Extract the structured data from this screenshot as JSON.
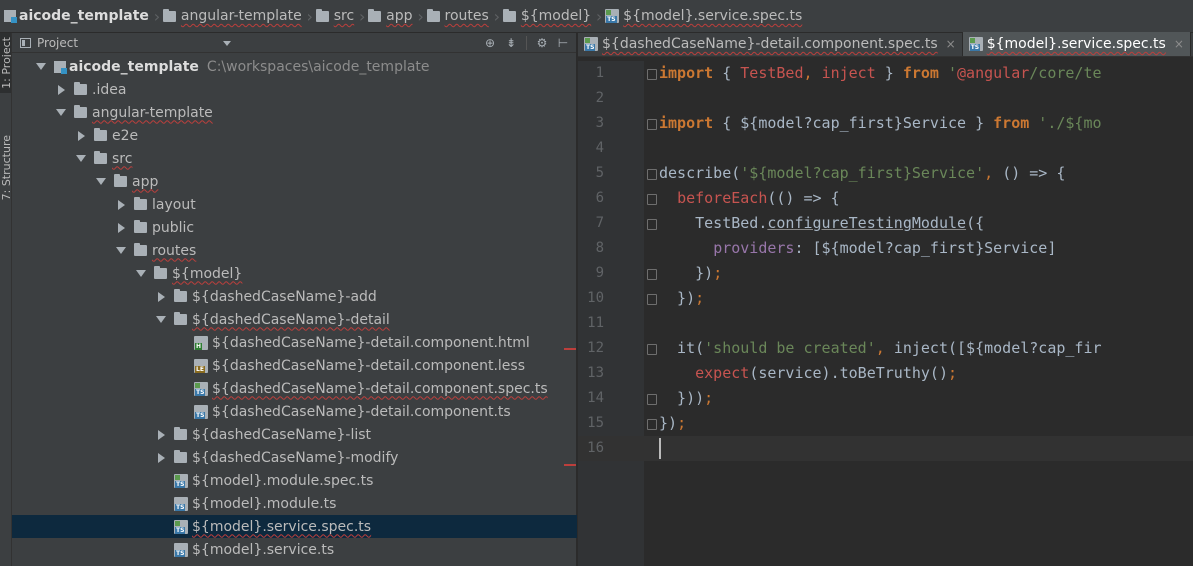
{
  "breadcrumb": [
    "aicode_template",
    "angular-template",
    "src",
    "app",
    "routes",
    "${model}",
    "${model}.service.spec.ts"
  ],
  "left_strip": {
    "project_tab": "1: Project",
    "structure_tab": "7: Structure"
  },
  "project_panel": {
    "title": "Project",
    "tools": [
      "locate-icon",
      "collapse-icon",
      "settings-icon",
      "hide-icon"
    ]
  },
  "tree": [
    {
      "label": "aicode_template",
      "path": "C:\\workspaces\\aicode_template",
      "level": 0,
      "toggle": "down",
      "icon": "module",
      "bold": true
    },
    {
      "label": ".idea",
      "level": 1,
      "toggle": "right",
      "icon": "folder"
    },
    {
      "label": "angular-template",
      "level": 1,
      "toggle": "down",
      "icon": "folder",
      "wavy": true
    },
    {
      "label": "e2e",
      "level": 2,
      "toggle": "right",
      "icon": "folder"
    },
    {
      "label": "src",
      "level": 2,
      "toggle": "down",
      "icon": "folder",
      "wavy": true
    },
    {
      "label": "app",
      "level": 3,
      "toggle": "down",
      "icon": "folder",
      "wavy": true
    },
    {
      "label": "layout",
      "level": 4,
      "toggle": "right",
      "icon": "folder"
    },
    {
      "label": "public",
      "level": 4,
      "toggle": "right",
      "icon": "folder"
    },
    {
      "label": "routes",
      "level": 4,
      "toggle": "down",
      "icon": "folder",
      "wavy": true
    },
    {
      "label": "${model}",
      "level": 5,
      "toggle": "down",
      "icon": "folder",
      "wavy": true
    },
    {
      "label": "${dashedCaseName}-add",
      "level": 6,
      "toggle": "right",
      "icon": "folder"
    },
    {
      "label": "${dashedCaseName}-detail",
      "level": 6,
      "toggle": "down",
      "icon": "folder",
      "wavy": true
    },
    {
      "label": "${dashedCaseName}-detail.component.html",
      "level": 7,
      "toggle": "none",
      "icon": "html"
    },
    {
      "label": "${dashedCaseName}-detail.component.less",
      "level": 7,
      "toggle": "none",
      "icon": "less"
    },
    {
      "label": "${dashedCaseName}-detail.component.spec.ts",
      "level": 7,
      "toggle": "none",
      "icon": "ts-spec",
      "wavy": true
    },
    {
      "label": "${dashedCaseName}-detail.component.ts",
      "level": 7,
      "toggle": "none",
      "icon": "ts"
    },
    {
      "label": "${dashedCaseName}-list",
      "level": 6,
      "toggle": "right",
      "icon": "folder"
    },
    {
      "label": "${dashedCaseName}-modify",
      "level": 6,
      "toggle": "right",
      "icon": "folder"
    },
    {
      "label": "${model}.module.spec.ts",
      "level": 6,
      "toggle": "none",
      "icon": "ts-spec"
    },
    {
      "label": "${model}.module.ts",
      "level": 6,
      "toggle": "none",
      "icon": "ts"
    },
    {
      "label": "${model}.service.spec.ts",
      "level": 6,
      "toggle": "none",
      "icon": "ts-spec",
      "selected": true,
      "wavy": true
    },
    {
      "label": "${model}.service.ts",
      "level": 6,
      "toggle": "none",
      "icon": "ts"
    }
  ],
  "editor_tabs": [
    {
      "label": "${dashedCaseName}-detail.component.spec.ts",
      "active": false
    },
    {
      "label": "${model}.service.spec.ts",
      "active": true
    }
  ],
  "code_lines": [
    {
      "n": "1",
      "fold": true,
      "tokens": [
        [
          "import",
          "kw"
        ],
        [
          " { ",
          "id"
        ],
        [
          "TestBed",
          "red"
        ],
        [
          ", ",
          "punc"
        ],
        [
          "inject",
          "red"
        ],
        [
          " } ",
          "id"
        ],
        [
          "from",
          "kw"
        ],
        [
          " '",
          "str"
        ],
        [
          "@angular",
          "red"
        ],
        [
          "/core/te",
          "str"
        ]
      ]
    },
    {
      "n": "2",
      "tokens": []
    },
    {
      "n": "3",
      "fold": true,
      "tokens": [
        [
          "import",
          "kw"
        ],
        [
          " { ${model?cap_first}Service } ",
          "id"
        ],
        [
          "from",
          "kw"
        ],
        [
          " './${mo",
          "str"
        ]
      ]
    },
    {
      "n": "4",
      "tokens": []
    },
    {
      "n": "5",
      "fold": true,
      "tokens": [
        [
          "describe",
          "id"
        ],
        [
          "(",
          "id"
        ],
        [
          "'${model?cap_first}Service'",
          "str"
        ],
        [
          ", ",
          "punc"
        ],
        [
          "() => {",
          "id"
        ]
      ]
    },
    {
      "n": "6",
      "fold": true,
      "tokens": [
        [
          "  "
        ],
        [
          "beforeEach",
          "fn"
        ],
        [
          "(() => {",
          "id"
        ]
      ]
    },
    {
      "n": "7",
      "fold": true,
      "tokens": [
        [
          "    TestBed.",
          "id"
        ],
        [
          "configureTestingModule",
          "u"
        ],
        [
          "({",
          "id"
        ]
      ]
    },
    {
      "n": "8",
      "tokens": [
        [
          "      "
        ],
        [
          "providers",
          "prop"
        ],
        [
          ": [${model?cap_first}Service]",
          "id"
        ]
      ]
    },
    {
      "n": "9",
      "fold": true,
      "tokens": [
        [
          "    })",
          "id"
        ],
        [
          ";",
          "punc"
        ]
      ]
    },
    {
      "n": "10",
      "fold": true,
      "tokens": [
        [
          "  })",
          "id"
        ],
        [
          ";",
          "punc"
        ]
      ]
    },
    {
      "n": "11",
      "tokens": []
    },
    {
      "n": "12",
      "fold": true,
      "tokens": [
        [
          "  it(",
          "id"
        ],
        [
          "'should be created'",
          "str"
        ],
        [
          ", ",
          "punc"
        ],
        [
          "inject([${model?cap_fir",
          "id"
        ]
      ]
    },
    {
      "n": "13",
      "tokens": [
        [
          "    "
        ],
        [
          "expect",
          "fn"
        ],
        [
          "(service).toBeTruthy()",
          "id"
        ],
        [
          ";",
          "punc"
        ]
      ]
    },
    {
      "n": "14",
      "fold": true,
      "tokens": [
        [
          "  }))",
          "id"
        ],
        [
          ";",
          "punc"
        ]
      ]
    },
    {
      "n": "15",
      "fold": true,
      "tokens": [
        [
          "})",
          "id"
        ],
        [
          ";",
          "punc"
        ]
      ]
    },
    {
      "n": "16",
      "current": true,
      "tokens": []
    }
  ]
}
